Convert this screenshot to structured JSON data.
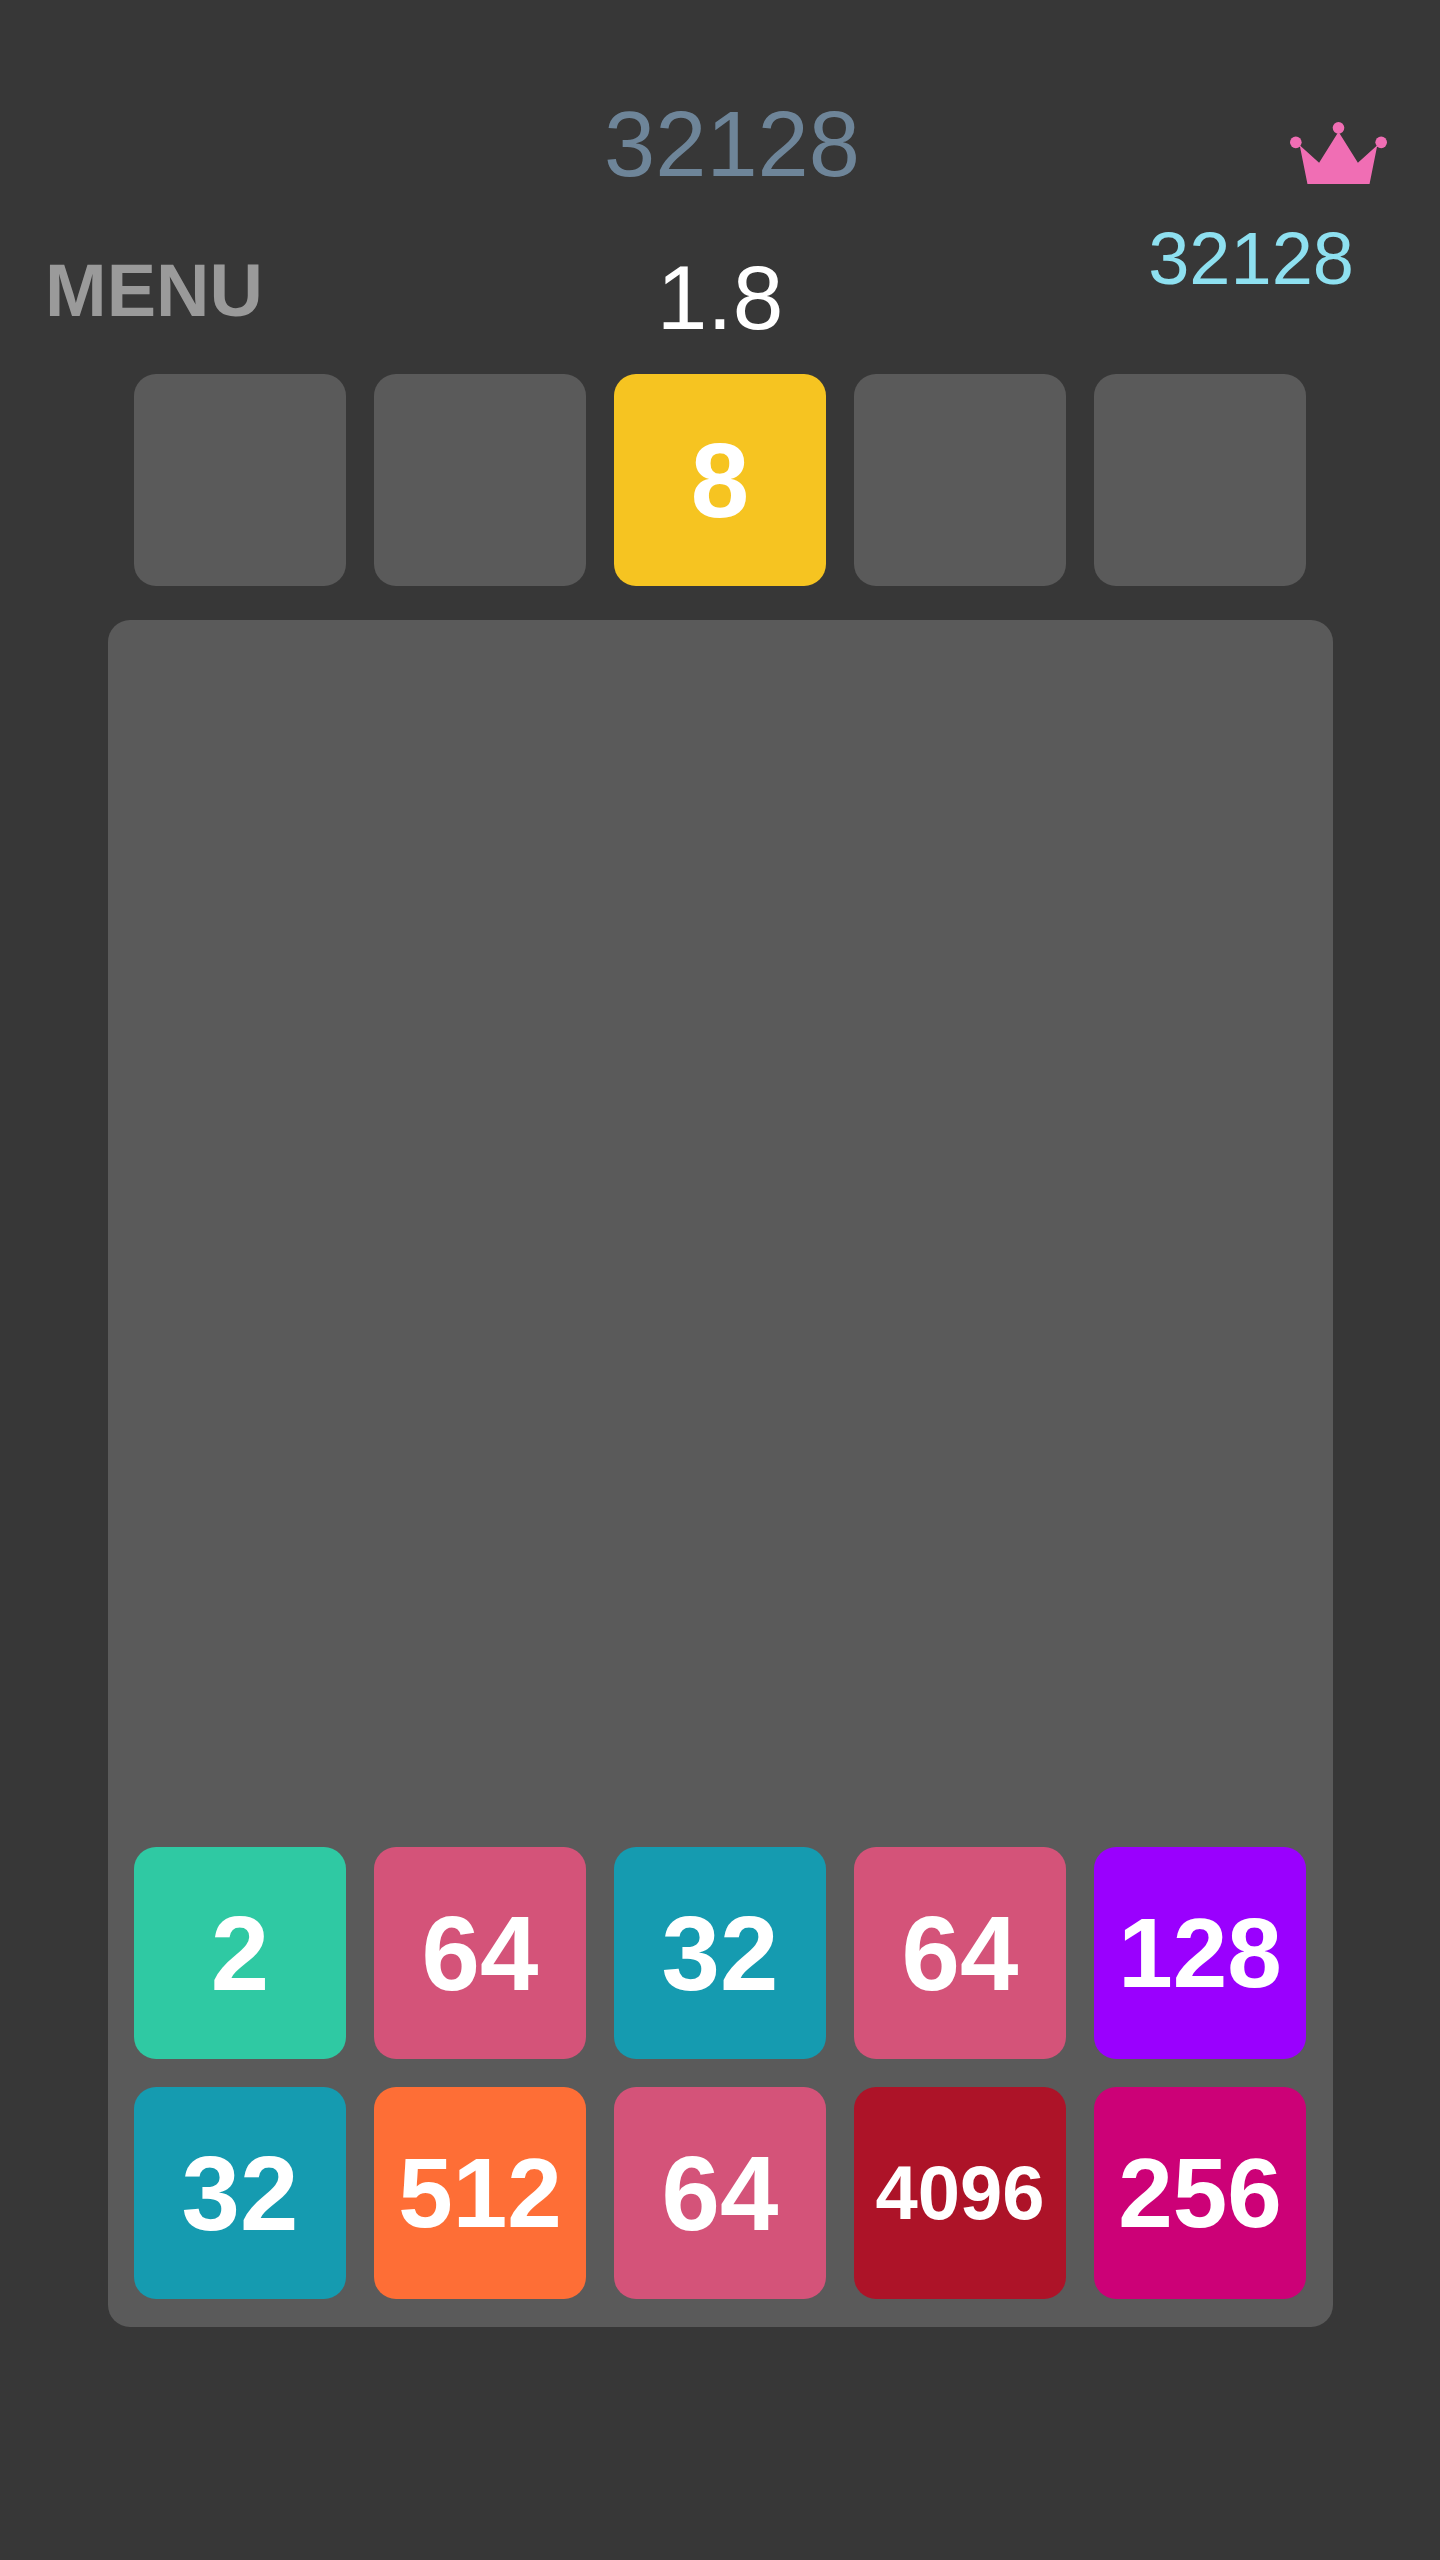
{
  "score": "32128",
  "best_score": "32128",
  "menu_button": {
    "label": "MENU"
  },
  "center_label": "1.8",
  "next_row": [
    {
      "kind": "empty"
    },
    {
      "kind": "empty"
    },
    {
      "kind": "tile",
      "value": "8",
      "color": "#f6c421"
    },
    {
      "kind": "empty"
    },
    {
      "kind": "empty"
    }
  ],
  "board": {
    "rows": [
      [
        {
          "value": "2",
          "color": "#2fc9a3"
        },
        {
          "value": "64",
          "color": "#d45379"
        },
        {
          "value": "32",
          "color": "#159bb0"
        },
        {
          "value": "64",
          "color": "#d45379"
        },
        {
          "value": "128",
          "color": "#9a00fe"
        }
      ],
      [
        {
          "value": "32",
          "color": "#159bb0"
        },
        {
          "value": "512",
          "color": "#fe6e36"
        },
        {
          "value": "64",
          "color": "#d45379"
        },
        {
          "value": "4096",
          "color": "#ad1328"
        },
        {
          "value": "256",
          "color": "#cc0177"
        }
      ]
    ]
  }
}
